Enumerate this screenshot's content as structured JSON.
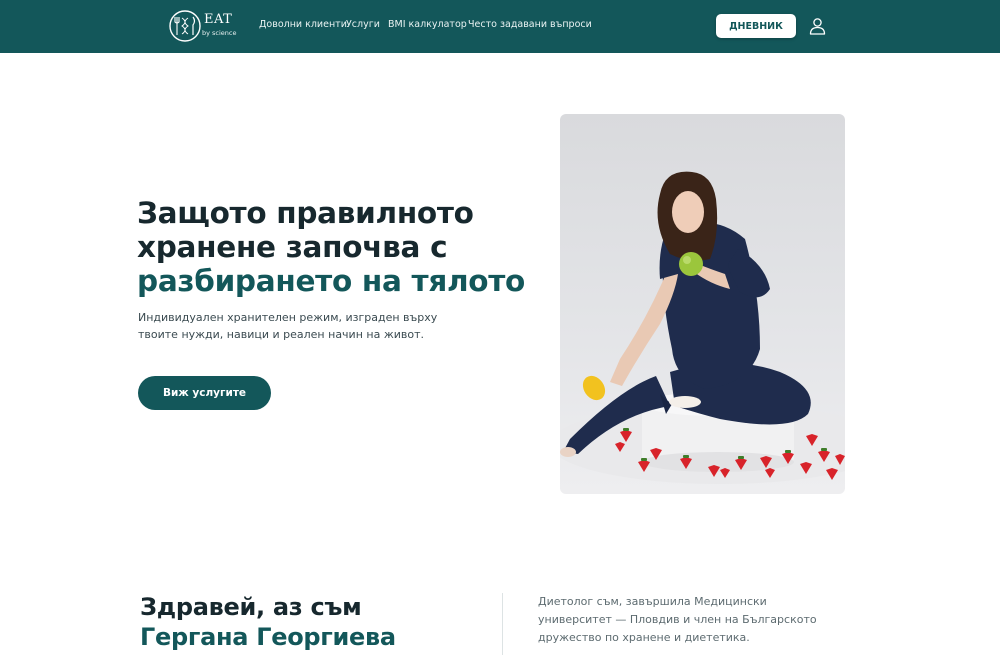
{
  "brand": {
    "name": "EAT",
    "tagline": "by science"
  },
  "nav": {
    "items": [
      {
        "label": "Доволни клиенти"
      },
      {
        "label": "Услуги"
      },
      {
        "label": "BMI калкулатор"
      },
      {
        "label": "Често задавани въпроси"
      }
    ],
    "diary_button": "ДНЕВНИК",
    "account_icon": "user-icon"
  },
  "hero": {
    "title_line1": "Защото правилното",
    "title_line2": "хранене започва с",
    "title_accent": "разбирането на тялото",
    "subtitle": "Индивидуален хранителен режим, изграден върху твоите нужди, навици и реален начин на живот.",
    "cta_label": "Виж услугите",
    "image": "dietitian-with-apple-photo"
  },
  "about": {
    "greeting": "Здравей, аз съм",
    "name": "Гергана Георгиева",
    "bio": "Диетолог съм, завършила Медицински университет — Пловдив и член на Българското дружество по хранене и диететика."
  },
  "colors": {
    "primary": "#13575a",
    "header_bg": "#13575a",
    "heading": "#17282e",
    "body_text": "#3a4a50",
    "muted_text": "#5d6b70"
  }
}
